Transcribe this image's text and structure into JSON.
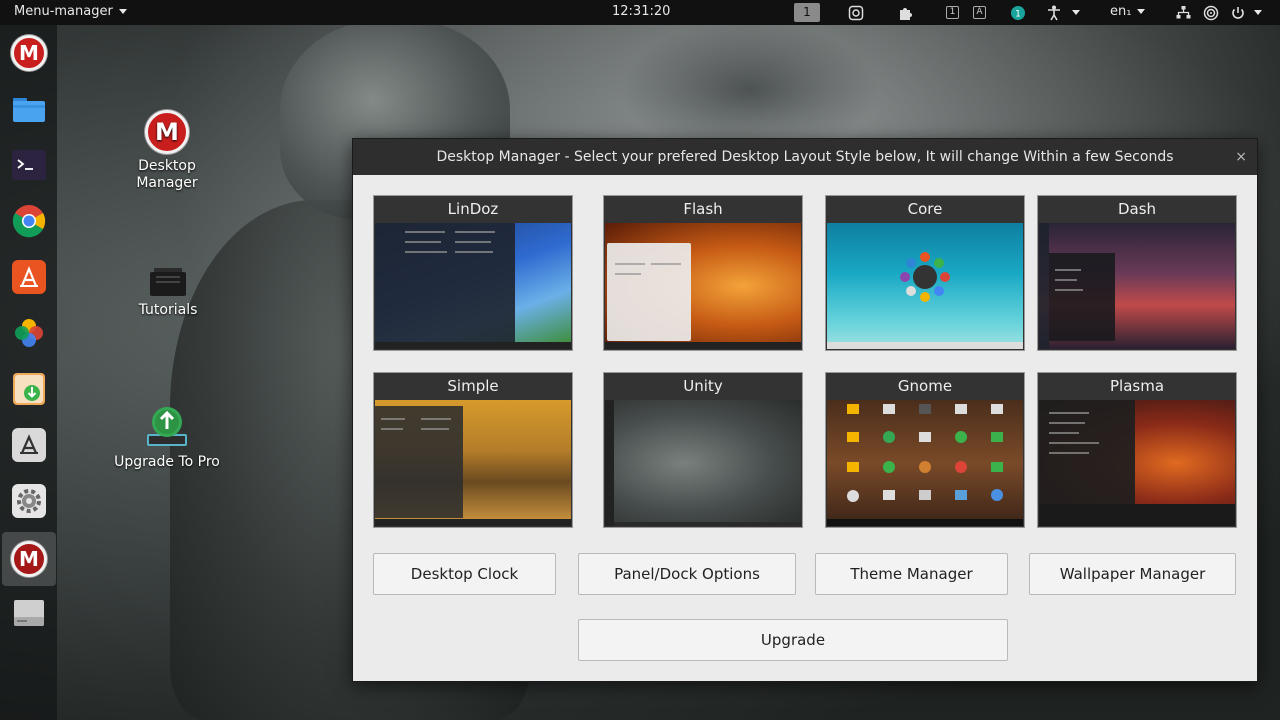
{
  "topbar": {
    "menu_label": "Menu-manager",
    "clock": "12:31:20",
    "workspace": "1",
    "kb1": "1",
    "kb2": "A",
    "lang": "en₁"
  },
  "dock": {
    "items": [
      "megaman",
      "files",
      "terminal",
      "chrome",
      "app-center",
      "photos",
      "downloader",
      "appgrid",
      "settings",
      "megaman-active",
      "drive"
    ]
  },
  "desktop": {
    "icons": [
      {
        "label": "Desktop Manager"
      },
      {
        "label": "Tutorials"
      },
      {
        "label": "Upgrade To Pro"
      }
    ]
  },
  "dialog": {
    "title": "Desktop Manager - Select your prefered Desktop Layout Style below, It will change Within a few Seconds",
    "close": "×",
    "layouts": [
      {
        "name": "LinDoz"
      },
      {
        "name": "Flash"
      },
      {
        "name": "Core"
      },
      {
        "name": "Dash"
      },
      {
        "name": "Simple"
      },
      {
        "name": "Unity"
      },
      {
        "name": "Gnome"
      },
      {
        "name": "Plasma"
      }
    ],
    "buttons": {
      "clock": "Desktop Clock",
      "panel": "Panel/Dock Options",
      "theme": "Theme Manager",
      "wallpaper": "Wallpaper Manager",
      "upgrade": "Upgrade"
    }
  },
  "colors": {
    "topbar": "#111111",
    "dialog_bg": "#ebebeb",
    "title_bg": "#2e2e2e",
    "brand_red": "#c81e1e"
  }
}
